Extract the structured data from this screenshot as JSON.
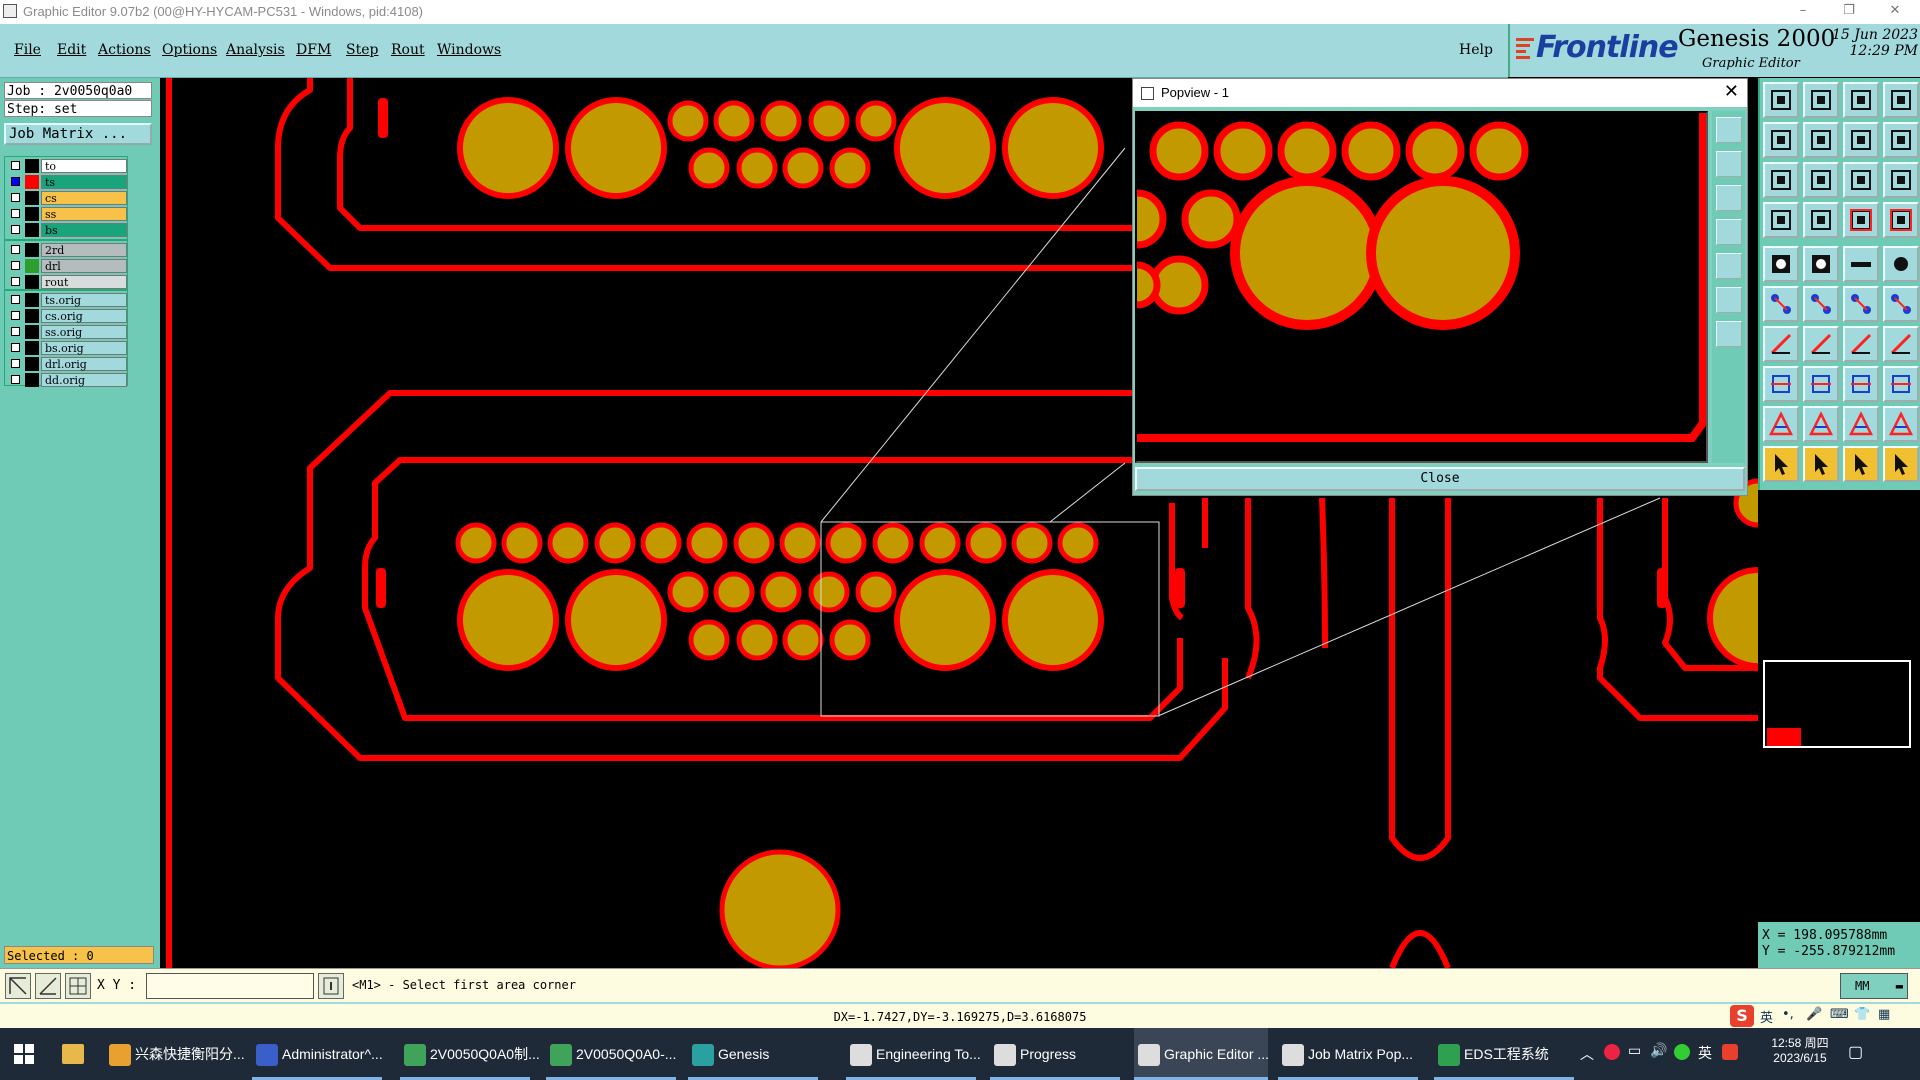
{
  "window": {
    "title": "Graphic Editor 9.07b2 (00@HY-HYCAM-PC531 - Windows, pid:4108)",
    "minimize": "–",
    "restore": "❐",
    "close": "✕"
  },
  "menu": {
    "items": [
      "File",
      "Edit",
      "Actions",
      "Options",
      "Analysis",
      "DFM",
      "Step",
      "Rout",
      "Windows"
    ],
    "help": "Help"
  },
  "brand": {
    "logo": "Frontline",
    "product": "Genesis 2000",
    "subtitle": "Graphic Editor",
    "date": "15 Jun 2023",
    "time": "12:29 PM"
  },
  "job": {
    "job_line": "Job : 2v0050q0a0",
    "step_line": "Step: set",
    "matrix_button": "Job Matrix ..."
  },
  "layers": {
    "group1": [
      {
        "name": "to",
        "color": "#ffffff",
        "swatch": "#000000",
        "checked": false
      },
      {
        "name": "ts",
        "color": "#1aa47c",
        "swatch": "#ff0000",
        "checked": true
      },
      {
        "name": "cs",
        "color": "#f6c24a",
        "swatch": "#000000",
        "checked": false
      },
      {
        "name": "ss",
        "color": "#f6c24a",
        "swatch": "#000000",
        "checked": false
      },
      {
        "name": "bs",
        "color": "#1aa47c",
        "swatch": "#000000",
        "checked": false
      }
    ],
    "group2": [
      {
        "name": "2rd",
        "color": "#b4bcbc",
        "swatch": "#000000",
        "checked": false
      },
      {
        "name": "drl",
        "color": "#b4bcbc",
        "swatch": "#2fa02f",
        "checked": false
      },
      {
        "name": "rout",
        "color": "#d9dcdc",
        "swatch": "#000000",
        "checked": false
      }
    ],
    "group3": [
      {
        "name": "ts.orig",
        "color": "#a2d9dd",
        "swatch": "#000000",
        "checked": false
      },
      {
        "name": "cs.orig",
        "color": "#a2d9dd",
        "swatch": "#000000",
        "checked": false
      },
      {
        "name": "ss.orig",
        "color": "#a2d9dd",
        "swatch": "#000000",
        "checked": false
      },
      {
        "name": "bs.orig",
        "color": "#a2d9dd",
        "swatch": "#000000",
        "checked": false
      },
      {
        "name": "drl.orig",
        "color": "#a2d9dd",
        "swatch": "#000000",
        "checked": false
      },
      {
        "name": "dd.orig",
        "color": "#a2d9dd",
        "swatch": "#000000",
        "checked": false
      }
    ]
  },
  "selected": "Selected : 0",
  "popview": {
    "title": "Popview - 1",
    "close_x": "✕",
    "close_button": "Close"
  },
  "coords": {
    "x": "X = 198.095788mm",
    "y": "Y = -255.879212mm"
  },
  "command": {
    "xy_label": "X Y :",
    "xy_value": "",
    "prompt": "<M1> - Select first area corner",
    "unit": "MM"
  },
  "measure": "DX=-1.7427,DY=-3.169275,D=3.6168075",
  "ime": {
    "lang": "英"
  },
  "taskbar": {
    "items": [
      {
        "label": "兴森快捷衡阳分...",
        "color": "#e8a030"
      },
      {
        "label": "Administrator^...",
        "color": "#3b5fc9"
      },
      {
        "label": "2V0050Q0A0制...",
        "color": "#3fa35a"
      },
      {
        "label": "2V0050Q0A0-...",
        "color": "#3fa35a"
      },
      {
        "label": "Genesis",
        "color": "#2aa0a0"
      },
      {
        "label": "Engineering To...",
        "color": "#dddddd"
      },
      {
        "label": "Progress",
        "color": "#dddddd"
      },
      {
        "label": "Graphic Editor ...",
        "color": "#dddddd"
      },
      {
        "label": "Job Matrix Pop...",
        "color": "#dddddd"
      },
      {
        "label": "EDS工程系统",
        "color": "#2ea04f"
      }
    ],
    "tray_lang": "英",
    "time": "12:58 周四",
    "date": "2023/6/15"
  },
  "colors": {
    "pad": "#c29a00",
    "trace": "#ff0000",
    "board": "#000000",
    "panel": "#6fcbb5",
    "menu": "#a2d9dd"
  }
}
